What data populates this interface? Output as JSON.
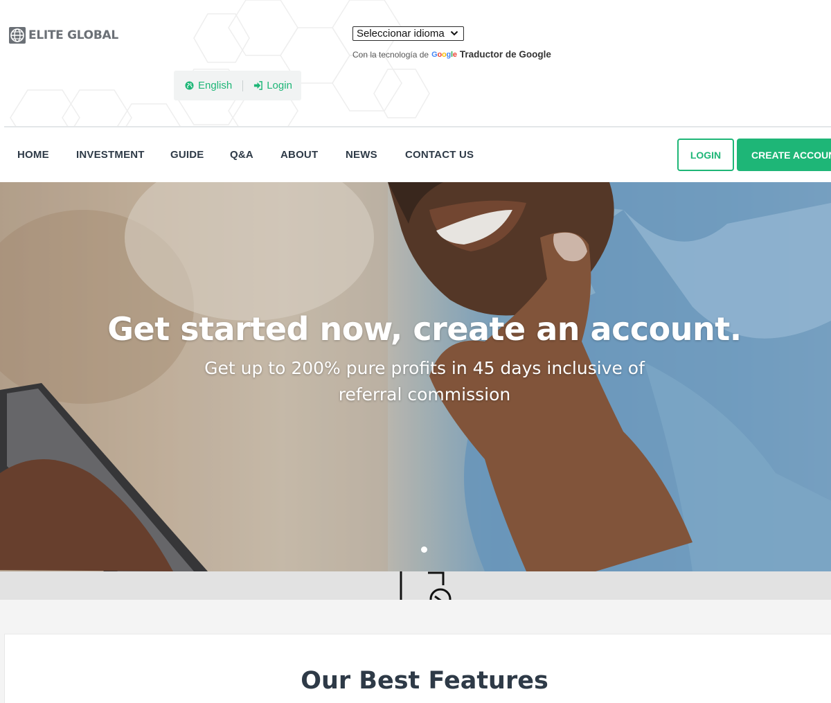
{
  "brand": {
    "name": "ELITE GLOBAL"
  },
  "translate": {
    "select_label": "Seleccionar idioma",
    "powered_prefix": "Con la tecnología de",
    "google_logo": "Google",
    "translate_link": "Traductor de Google"
  },
  "topbar": {
    "language_label": "English",
    "language_icon": "globe-icon",
    "login_label": "Login",
    "login_icon": "sign-in-icon"
  },
  "nav": {
    "items": [
      {
        "label": "HOME"
      },
      {
        "label": "INVESTMENT"
      },
      {
        "label": "GUIDE"
      },
      {
        "label": "Q&A"
      },
      {
        "label": "ABOUT"
      },
      {
        "label": "NEWS"
      },
      {
        "label": "CONTACT US"
      }
    ],
    "login_button": "LOGIN",
    "create_account_button": "CREATE ACCOUNT"
  },
  "hero": {
    "title": "Get started now, create an account.",
    "subtitle": "Get up to 200% pure profits in 45 days inclusive of referral commission",
    "active_slide": 1
  },
  "features": {
    "title": "Our Best Features"
  },
  "colors": {
    "accent": "#1eb677",
    "text_dark": "#2e3a47",
    "logo_gray": "#6b7076"
  }
}
